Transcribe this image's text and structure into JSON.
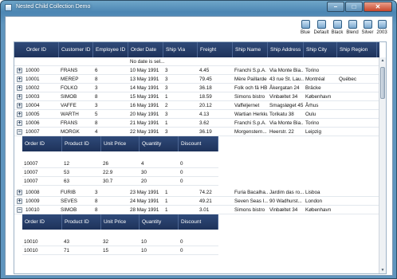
{
  "window": {
    "title": "Nested Child Collection Demo"
  },
  "toolbar": {
    "themes": [
      {
        "label": "Blue",
        "icon": "theme-blue-icon"
      },
      {
        "label": "Default",
        "icon": "theme-default-icon"
      },
      {
        "label": "Black",
        "icon": "theme-black-icon"
      },
      {
        "label": "Blend",
        "icon": "theme-blend-icon"
      },
      {
        "label": "Silver",
        "icon": "theme-silver-icon"
      },
      {
        "label": "2003",
        "icon": "theme-2003-icon"
      }
    ]
  },
  "grid": {
    "columns": [
      "Order ID",
      "Customer ID",
      "Employee ID",
      "Order Date",
      "Ship Via",
      "Freight",
      "Ship Name",
      "Ship Address",
      "Ship City",
      "Ship Region"
    ],
    "filter_text": "No date is sel...",
    "rows": [
      [
        "10000",
        "FRANS",
        "6",
        "10 May 1991",
        "3",
        "4.45",
        "Franchi S.p.A.",
        "Via Monte Bia...",
        "Torino",
        ""
      ],
      [
        "10001",
        "MEREP",
        "8",
        "13 May 1991",
        "3",
        "79.45",
        "Mère Paillarde",
        "43 rue St. Lau...",
        "Montréal",
        "Québec"
      ],
      [
        "10002",
        "FOLKO",
        "3",
        "14 May 1991",
        "3",
        "36.18",
        "Folk och fä HB",
        "Åkergatan 24",
        "Bräcke",
        ""
      ],
      [
        "10003",
        "SIMOB",
        "8",
        "15 May 1991",
        "1",
        "18.59",
        "Simons bistro",
        "Vinbæltet 34",
        "København",
        ""
      ],
      [
        "10004",
        "VAFFE",
        "3",
        "16 May 1991",
        "2",
        "20.12",
        "Vaffeljernet",
        "Smagsløget 45",
        "Århus",
        ""
      ],
      [
        "10005",
        "WARTH",
        "5",
        "20 May 1991",
        "3",
        "4.13",
        "Wartian Herkku",
        "Torikatu 38",
        "Oulu",
        ""
      ],
      [
        "10006",
        "FRANS",
        "8",
        "21 May 1991",
        "1",
        "3.62",
        "Franchi S.p.A.",
        "Via Monte Bia...",
        "Torino",
        ""
      ],
      [
        "10007",
        "MORGK",
        "4",
        "22 May 1991",
        "3",
        "36.19",
        "Morgenstern...",
        "Heerstr. 22",
        "Leipzig",
        ""
      ]
    ],
    "rows_after_child1": [
      [
        "10008",
        "FURIB",
        "3",
        "23 May 1991",
        "1",
        "74.22",
        "Furia Bacalha...",
        "Jardim das ro...",
        "Lisboa",
        ""
      ],
      [
        "10009",
        "SEVES",
        "8",
        "24 May 1991",
        "1",
        "49.21",
        "Seven Seas I...",
        "90 Wadhurst...",
        "London",
        ""
      ],
      [
        "10010",
        "SIMOB",
        "8",
        "28 May 1991",
        "1",
        "3.01",
        "Simons bistro",
        "Vinbæltet 34",
        "København",
        ""
      ]
    ],
    "child_columns": [
      "Order ID",
      "Product ID",
      "Unit Price",
      "Quantity",
      "Discount"
    ],
    "child1_rows": [
      [
        "10007",
        "12",
        "26",
        "4",
        "0"
      ],
      [
        "10007",
        "53",
        "22.9",
        "30",
        "0"
      ],
      [
        "10007",
        "63",
        "30.7",
        "20",
        "0"
      ]
    ],
    "child2_rows": [
      [
        "10010",
        "43",
        "32",
        "10",
        "0"
      ],
      [
        "10010",
        "71",
        "15",
        "10",
        "0"
      ]
    ]
  }
}
